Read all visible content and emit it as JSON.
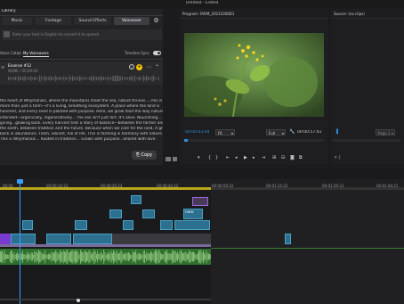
{
  "window": {
    "title": "Untitled - Edited"
  },
  "library": {
    "title": "Library",
    "tabs": [
      {
        "label": "Music",
        "active": false
      },
      {
        "label": "Footage",
        "active": false
      },
      {
        "label": "Sound Effects",
        "active": false
      },
      {
        "label": "Voiceover",
        "active": true
      }
    ],
    "prompt_placeholder": "Enter your text in English to convert it to speech",
    "subtabs": [
      {
        "label": "Voice Catalog"
      },
      {
        "label": "My Voiceovers"
      }
    ],
    "timeline_sync_label": "Timeline Sync",
    "voice": {
      "name": "Essence #12",
      "meta": "NONE / 00:00:00"
    },
    "transcript": [
      "the heart of Whymanalc, where the mountains meet the sea, nature thrives....This is",
      "more than just a farm—it's a living, breathing ecosystem. A place where the land is",
      "honored, and every seed is planted with purpose. Here, we grow food the way nature",
      "intended—organically, regeneratively... The soil isn't just dirt. It's alive. Nourishing...",
      "giving...glowing back. Every harvest tells a story of balance—between the farmer and",
      "the earth, between tradition and the future. Because when we care for the land, it gives",
      "back in abundance. Fresh, vibrant, full of life. This is farming in harmony with nature.",
      "This is Whymanalc... Rooted in tradition... Grown with purpose...Shared with love."
    ],
    "copy_label": "Copy"
  },
  "program": {
    "title": "Program: FARM_20231008D1",
    "timecode_current": "00:00:03:04",
    "fit_label": "Fit",
    "quality_label": "Full",
    "timecode_duration": "00:00:57:01"
  },
  "source": {
    "title": "Source: (no clips)",
    "page_label": "Page 1"
  },
  "timeline": {
    "ruler": [
      "00:00",
      "00:00:14:23",
      "00:00:29:23",
      "00:00:44:22",
      "00:00:59:22",
      "00:01:14:22",
      "00:01:29:21",
      "00:01:44:21"
    ],
    "clip_label": "FARM"
  },
  "colors": {
    "accent": "#2e8fd6",
    "clip_blue": "#2c6f8f",
    "clip_purple": "#7a3ad1",
    "audio_green": "#2e7d32",
    "playhead": "#3aa0ff"
  }
}
